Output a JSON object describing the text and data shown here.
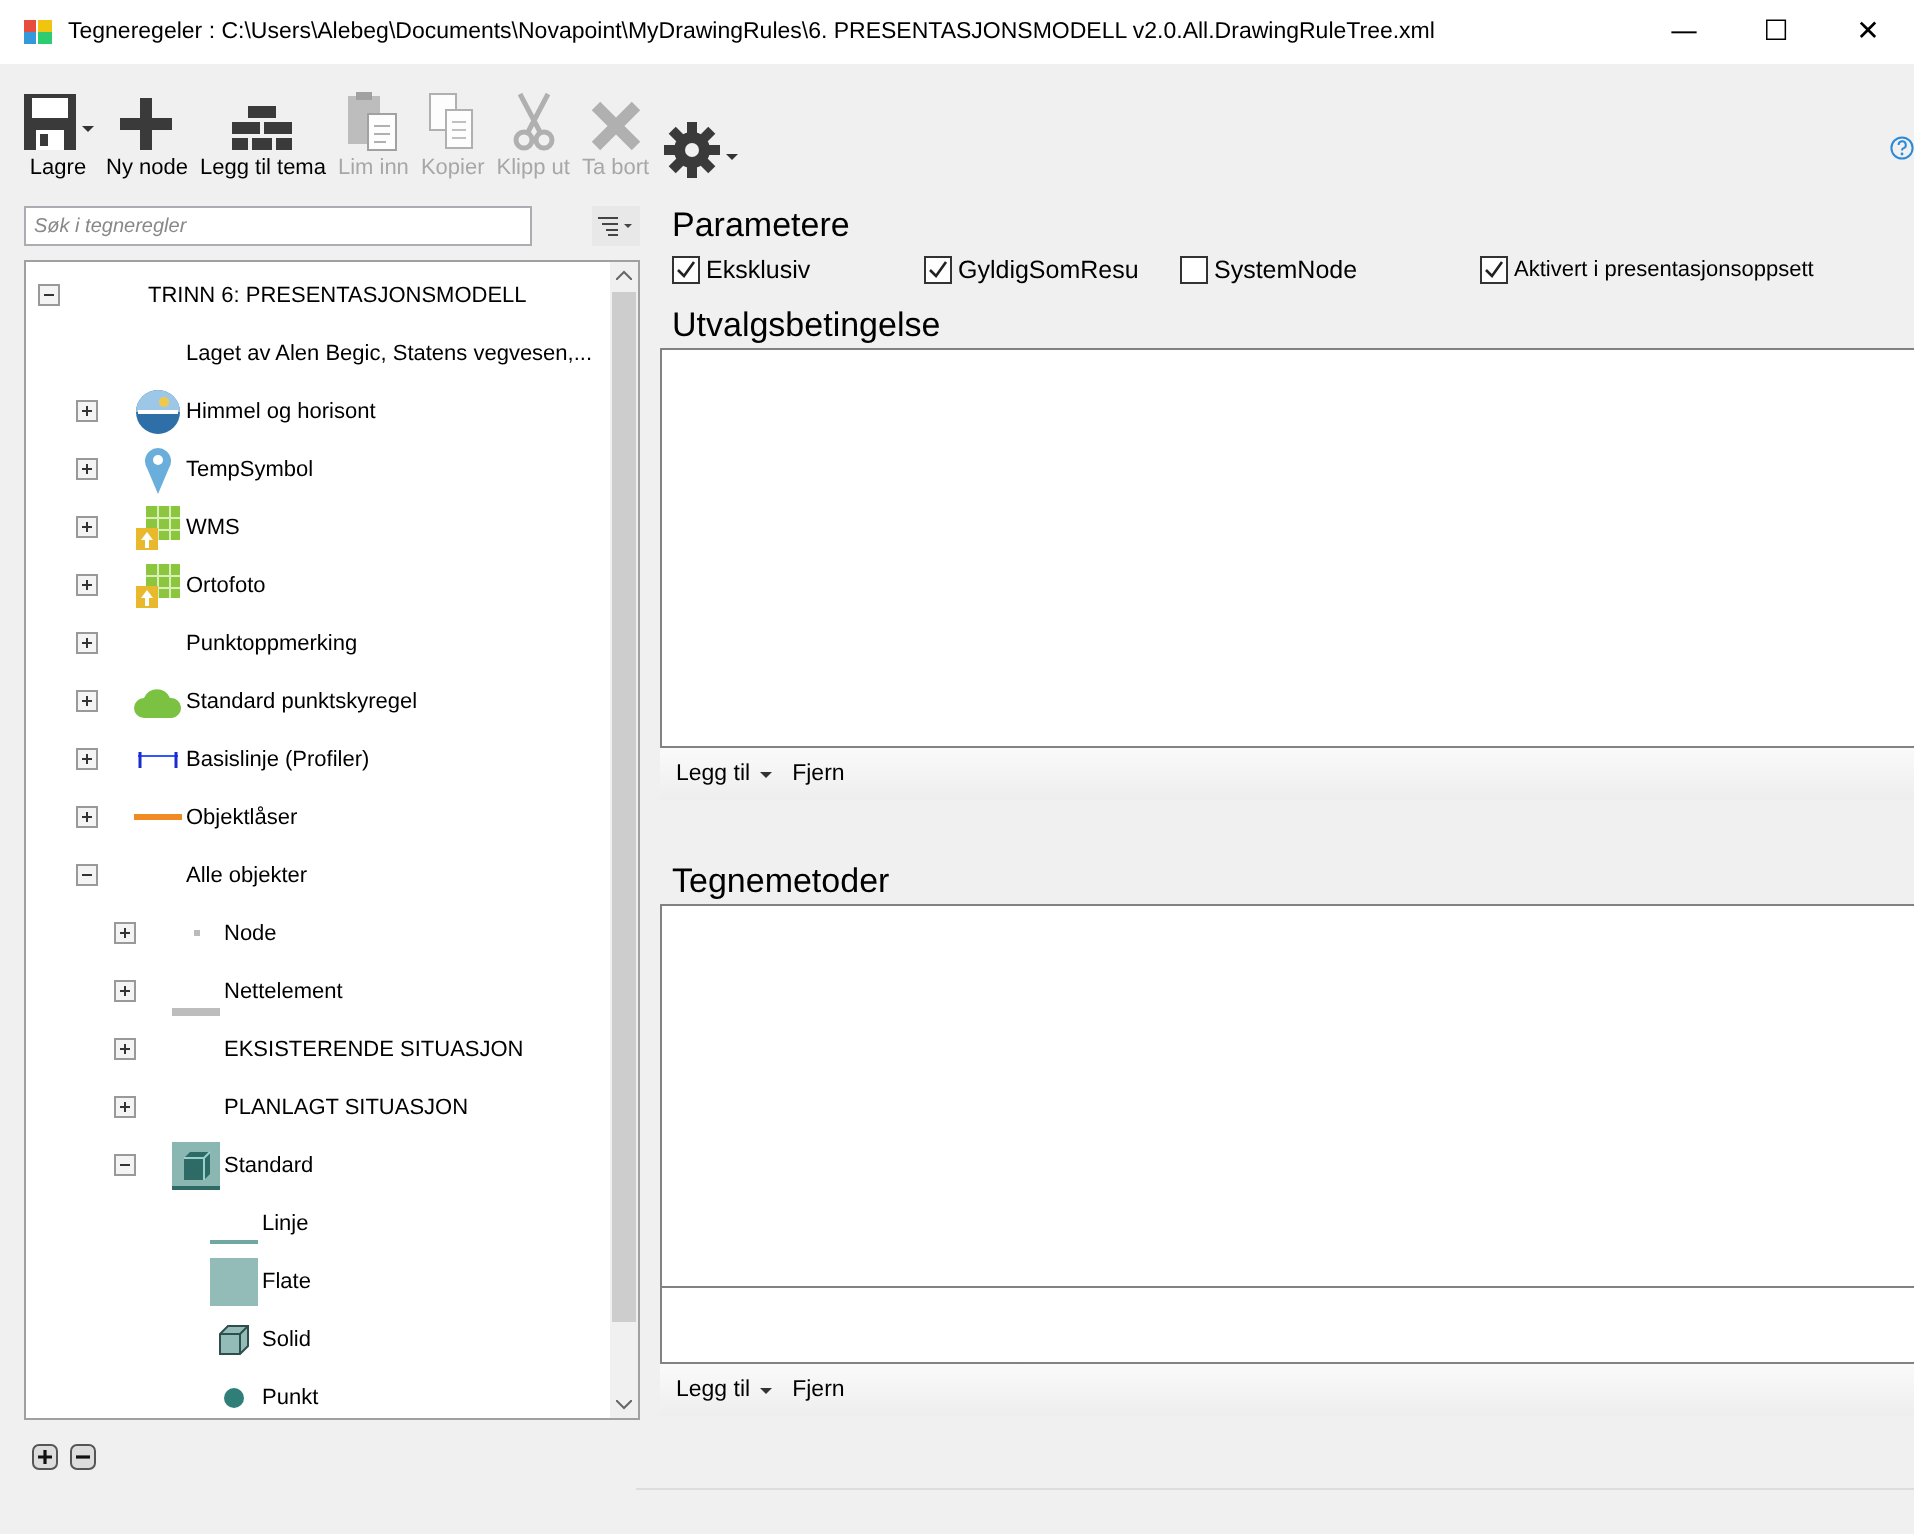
{
  "window": {
    "title": "Tegneregeler : C:\\Users\\Alebeg\\Documents\\Novapoint\\MyDrawingRules\\6. PRESENTASJONSMODELL v2.0.All.DrawingRuleTree.xml",
    "controls": [
      "—",
      "☐",
      "✕"
    ]
  },
  "toolbar": [
    {
      "kind": "save",
      "label": "Lagre",
      "disabled": false,
      "dropdown": true
    },
    {
      "kind": "plus",
      "label": "Ny node",
      "disabled": false,
      "dropdown": false
    },
    {
      "kind": "bricks",
      "label": "Legg til tema",
      "disabled": false,
      "dropdown": false
    },
    {
      "kind": "paste",
      "label": "Lim inn",
      "disabled": true,
      "dropdown": false
    },
    {
      "kind": "copy",
      "label": "Kopier",
      "disabled": true,
      "dropdown": false
    },
    {
      "kind": "cut",
      "label": "Klipp ut",
      "disabled": true,
      "dropdown": false
    },
    {
      "kind": "delete",
      "label": "Ta bort",
      "disabled": true,
      "dropdown": false
    },
    {
      "kind": "gear",
      "disabled": false,
      "dropdown": true
    }
  ],
  "search": {
    "placeholder": "Søk i tegneregler"
  },
  "tree": [
    {
      "label": "TRINN 6: PRESENTASJONSMODELL",
      "expanded": true,
      "children": [
        {
          "label": "Laget av Alen Begic, Statens vegvesen,..."
        },
        {
          "label": "Himmel og horisont",
          "expanded": false,
          "kind": "sky"
        },
        {
          "label": "TempSymbol",
          "expanded": false,
          "kind": "pin"
        },
        {
          "label": "WMS",
          "expanded": false,
          "kind": "map"
        },
        {
          "label": "Ortofoto",
          "expanded": false,
          "kind": "map"
        },
        {
          "label": "Punktoppmerking",
          "expanded": false
        },
        {
          "label": "Standard punktskyregel",
          "expanded": false,
          "kind": "cloud"
        },
        {
          "label": "Basislinje (Profiler)",
          "expanded": false,
          "kind": "baseline"
        },
        {
          "label": "Objektlåser",
          "expanded": false,
          "kind": "orange-line"
        },
        {
          "label": "Alle objekter",
          "expanded": true,
          "children": [
            {
              "label": "Node",
              "expanded": false,
              "kind": "small-dot"
            },
            {
              "label": "Nettelement",
              "expanded": false,
              "kind": "gray-line"
            },
            {
              "label": "EKSISTERENDE SITUASJON",
              "expanded": false
            },
            {
              "label": "PLANLAGT SITUASJON",
              "expanded": false
            },
            {
              "label": "Standard",
              "expanded": true,
              "kind": "cube-tile",
              "children": [
                {
                  "label": "Linje",
                  "kind": "line"
                },
                {
                  "label": "Flate",
                  "kind": "square"
                },
                {
                  "label": "Solid",
                  "kind": "cube"
                },
                {
                  "label": "Punkt",
                  "kind": "dot"
                }
              ]
            }
          ]
        }
      ]
    }
  ],
  "parameters": {
    "title": "Parametere",
    "checkboxes": [
      {
        "label": "Eksklusiv",
        "checked": true
      },
      {
        "label": "GyldigSomResu",
        "checked": true
      },
      {
        "label": "SystemNode",
        "checked": false
      },
      {
        "label": "Aktivert i presentasjonsoppsett",
        "checked": true
      }
    ]
  },
  "selection": {
    "title": "Utvalgsbetingelse",
    "add": "Legg til",
    "remove": "Fjern"
  },
  "methods": {
    "title": "Tegnemetoder",
    "add": "Legg til",
    "remove": "Fjern"
  }
}
